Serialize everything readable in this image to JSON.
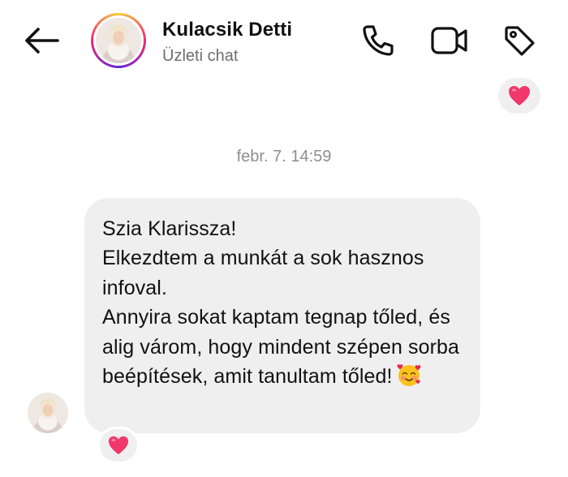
{
  "header": {
    "contact_name": "Kulacsik Detti",
    "subtitle": "Üzleti chat",
    "icons": [
      "back-arrow-icon",
      "phone-icon",
      "video-camera-icon",
      "tag-icon"
    ]
  },
  "top_reaction": {
    "emoji": "heart",
    "color": "#f0386b"
  },
  "timestamp": "febr. 7. 14:59",
  "message": {
    "text": "Szia Klarissza!\nElkezdtem a munkát a sok hasznos infoval.\nAnnyira sokat kaptam tegnap tőled, és alig várom, hogy mindent szépen sorba beépítések, amit tanultam tőled!",
    "emoji": "smiling-face-with-hearts",
    "reaction": "heart"
  },
  "colors": {
    "bubble": "#efefef",
    "heart": "#f0386b",
    "secondary_text": "#6e6e6e",
    "story_ring": [
      "#f9ce34",
      "#ee2a7b",
      "#6228d7"
    ]
  }
}
